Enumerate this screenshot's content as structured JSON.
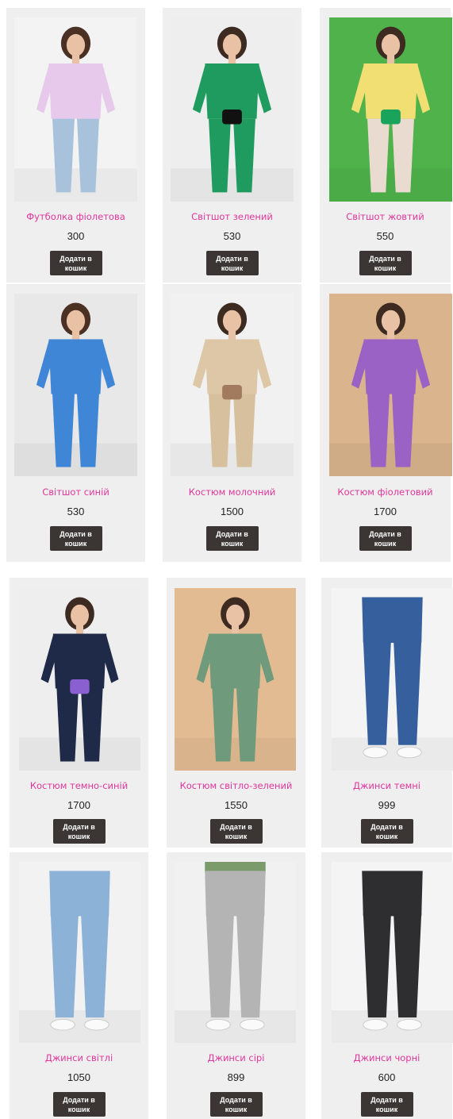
{
  "cart_label": "Додати в кошик",
  "colors": {
    "name": "#e0359b",
    "button": "#3b3633",
    "card": "#efefef"
  },
  "products": [
    {
      "name": "Футболка фіолетова",
      "price": "300",
      "bg": "#f3f3f3",
      "top": "#e7c9ec",
      "bottom": "#a9c2dc",
      "hair": "#4a3124",
      "accent": ""
    },
    {
      "name": "Світшот зелений",
      "price": "530",
      "bg": "#eeeeee",
      "top": "#1f9b5f",
      "bottom": "#1f9b5f",
      "hair": "#3d2a20",
      "accent": "#111111"
    },
    {
      "name": "Світшот жовтий",
      "price": "550",
      "bg": "#4fb24a",
      "top": "#f2df73",
      "bottom": "#eadbd0",
      "hair": "#3d2a20",
      "accent": "#1aa35a"
    },
    {
      "name": "Світшот синій",
      "price": "530",
      "bg": "#e8e8e8",
      "top": "#3f86d6",
      "bottom": "#3f86d6",
      "hair": "#4a3124",
      "accent": ""
    },
    {
      "name": "Костюм молочний",
      "price": "1500",
      "bg": "#f1f1f1",
      "top": "#ddc7a6",
      "bottom": "#d6c09e",
      "hair": "#3d2a20",
      "accent": "#a27a5d"
    },
    {
      "name": "Костюм фіолетовий",
      "price": "1700",
      "bg": "#d9b48c",
      "top": "#9a62c4",
      "bottom": "#9a62c4",
      "hair": "#3d2a20",
      "accent": ""
    },
    {
      "name": "Костюм темно-синій",
      "price": "1700",
      "bg": "#eeeeee",
      "top": "#1f2a48",
      "bottom": "#1f2a48",
      "hair": "#3d2a20",
      "accent": "#8a5fd0"
    },
    {
      "name": "Костюм світло-зелений",
      "price": "1550",
      "bg": "#e2bb92",
      "top": "#6f9a7b",
      "bottom": "#6f9a7b",
      "hair": "#3d2a20",
      "accent": ""
    },
    {
      "name": "Джинси темні",
      "price": "999",
      "bg": "#f4f4f4",
      "top": "#f4f4f4",
      "bottom": "#365f9e",
      "hair": "",
      "accent": ""
    },
    {
      "name": "Джинси світлі",
      "price": "1050",
      "bg": "#f2f2f2",
      "top": "#f2f2f2",
      "bottom": "#8cb2d8",
      "hair": "",
      "accent": ""
    },
    {
      "name": "Джинси сірі",
      "price": "899",
      "bg": "#f1f1f1",
      "top": "#7c9b6a",
      "bottom": "#b4b4b4",
      "hair": "",
      "accent": ""
    },
    {
      "name": "Джинси чорні",
      "price": "600",
      "bg": "#f4f4f4",
      "top": "#f4f4f4",
      "bottom": "#2e2e30",
      "hair": "",
      "accent": ""
    }
  ]
}
